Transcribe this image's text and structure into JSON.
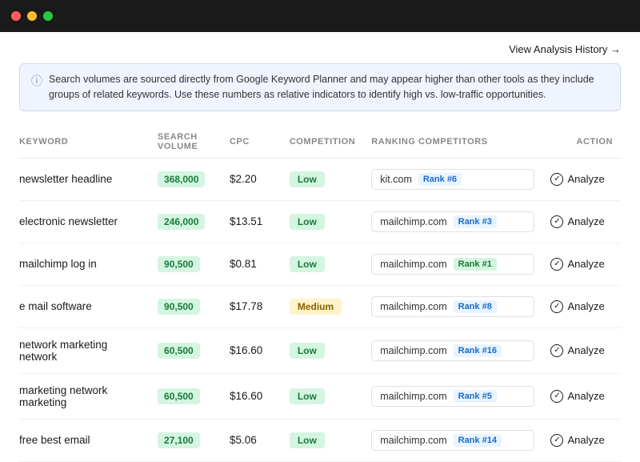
{
  "titleBar": {
    "lights": [
      "red",
      "yellow",
      "green"
    ]
  },
  "header": {
    "viewHistoryLabel": "View Analysis History →"
  },
  "infoBanner": {
    "text": "Search volumes are sourced directly from Google Keyword Planner and may appear higher than other tools as they include groups of related keywords. Use these numbers as relative indicators to identify high vs. low-traffic opportunities."
  },
  "table": {
    "columns": [
      {
        "key": "keyword",
        "label": "KEYWORD"
      },
      {
        "key": "volume",
        "label": "SEARCH VOLUME"
      },
      {
        "key": "cpc",
        "label": "CPC"
      },
      {
        "key": "competition",
        "label": "COMPETITION"
      },
      {
        "key": "competitors",
        "label": "RANKING COMPETITORS"
      },
      {
        "key": "action",
        "label": "ACTION"
      }
    ],
    "rows": [
      {
        "keyword": "newsletter headline",
        "volume": "368,000",
        "cpc": "$2.20",
        "competition": "Low",
        "competitionLevel": "low",
        "competitorDomain": "kit.com",
        "competitorRank": "Rank #6",
        "rankLevel": "normal",
        "action": "Analyze"
      },
      {
        "keyword": "electronic newsletter",
        "volume": "246,000",
        "cpc": "$13.51",
        "competition": "Low",
        "competitionLevel": "low",
        "competitorDomain": "mailchimp.com",
        "competitorRank": "Rank #3",
        "rankLevel": "normal",
        "action": "Analyze"
      },
      {
        "keyword": "mailchimp log in",
        "volume": "90,500",
        "cpc": "$0.81",
        "competition": "Low",
        "competitionLevel": "low",
        "competitorDomain": "mailchimp.com",
        "competitorRank": "Rank #1",
        "rankLevel": "top",
        "action": "Analyze"
      },
      {
        "keyword": "e mail software",
        "volume": "90,500",
        "cpc": "$17.78",
        "competition": "Medium",
        "competitionLevel": "medium",
        "competitorDomain": "mailchimp.com",
        "competitorRank": "Rank #8",
        "rankLevel": "normal",
        "action": "Analyze"
      },
      {
        "keyword": "network marketing network",
        "volume": "60,500",
        "cpc": "$16.60",
        "competition": "Low",
        "competitionLevel": "low",
        "competitorDomain": "mailchimp.com",
        "competitorRank": "Rank #16",
        "rankLevel": "normal",
        "action": "Analyze"
      },
      {
        "keyword": "marketing network marketing",
        "volume": "60,500",
        "cpc": "$16.60",
        "competition": "Low",
        "competitionLevel": "low",
        "competitorDomain": "mailchimp.com",
        "competitorRank": "Rank #5",
        "rankLevel": "normal",
        "action": "Analyze"
      },
      {
        "keyword": "free best email",
        "volume": "27,100",
        "cpc": "$5.06",
        "competition": "Low",
        "competitionLevel": "low",
        "competitorDomain": "mailchimp.com",
        "competitorRank": "Rank #14",
        "rankLevel": "normal",
        "action": "Analyze"
      }
    ]
  }
}
